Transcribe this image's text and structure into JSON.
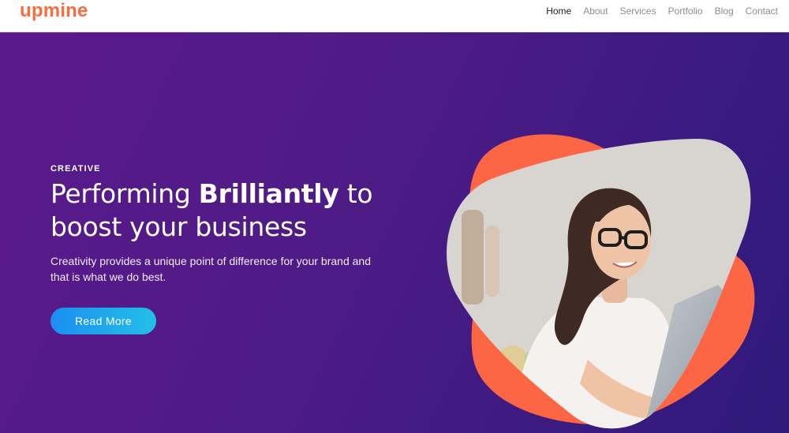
{
  "brand": {
    "logo": "upmine",
    "color": "#fd6b3d"
  },
  "nav": {
    "items": [
      {
        "label": "Home",
        "active": true
      },
      {
        "label": "About",
        "active": false
      },
      {
        "label": "Services",
        "active": false
      },
      {
        "label": "Portfolio",
        "active": false
      },
      {
        "label": "Blog",
        "active": false
      },
      {
        "label": "Contact",
        "active": false
      }
    ]
  },
  "hero": {
    "eyebrow": "CREATIVE",
    "headline_pre": "Performing ",
    "headline_bold": "Brilliantly",
    "headline_mid": " to",
    "headline_line2": "boost your business",
    "subtext": "Creativity provides a unique point of difference for your brand and that is what we do best.",
    "cta_label": "Read More",
    "gradient_start": "#5b1a8c",
    "gradient_end": "#2f1a7a",
    "cta_gradient": [
      "#1c8ef2",
      "#22c0e6"
    ],
    "accent_shape_color": "#fd6644"
  }
}
